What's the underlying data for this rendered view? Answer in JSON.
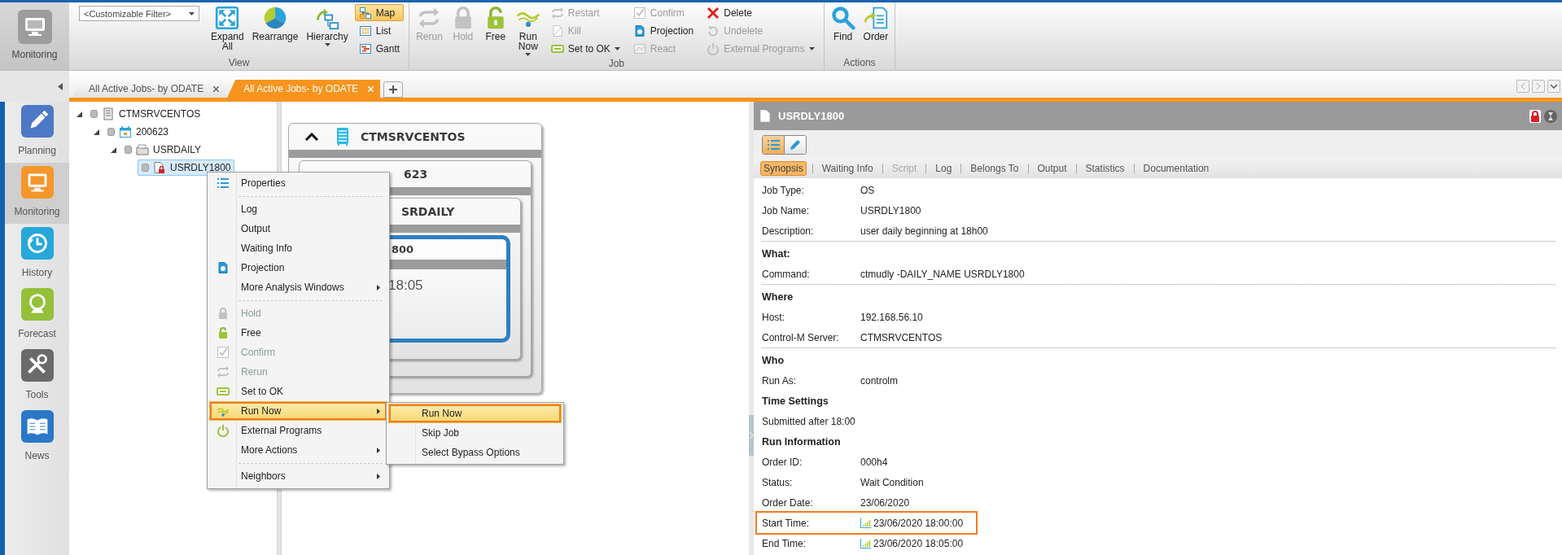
{
  "app_button": {
    "label": "Monitoring"
  },
  "filter": {
    "value": "<Customizable Filter>"
  },
  "ribbon_groups": [
    {
      "label": "View",
      "items": [
        {
          "kind": "large",
          "label": "Expand All",
          "disabled": false,
          "dropdown": false
        },
        {
          "kind": "large",
          "label": "Rearrange",
          "disabled": false,
          "dropdown": false
        },
        {
          "kind": "large",
          "label": "Hierarchy",
          "disabled": false,
          "dropdown": true
        },
        {
          "kind": "stack",
          "items": [
            {
              "label": "Map",
              "selected": true,
              "disabled": false,
              "dropdown": false
            },
            {
              "label": "List",
              "selected": false,
              "disabled": false,
              "dropdown": false
            },
            {
              "label": "Gantt",
              "selected": false,
              "disabled": false,
              "dropdown": false
            }
          ]
        }
      ]
    },
    {
      "label": "Job",
      "items": [
        {
          "kind": "large",
          "label": "Rerun",
          "disabled": true,
          "dropdown": false
        },
        {
          "kind": "large",
          "label": "Hold",
          "disabled": true,
          "dropdown": false
        },
        {
          "kind": "large",
          "label": "Free",
          "disabled": false,
          "dropdown": false
        },
        {
          "kind": "large",
          "label": "Run Now",
          "disabled": false,
          "dropdown": true
        },
        {
          "kind": "stack",
          "items": [
            {
              "label": "Restart",
              "disabled": true,
              "dropdown": false
            },
            {
              "label": "Kill",
              "disabled": true,
              "dropdown": false
            },
            {
              "label": "Set to OK",
              "disabled": false,
              "dropdown": true
            }
          ]
        },
        {
          "kind": "stack",
          "items": [
            {
              "label": "Confirm",
              "disabled": true,
              "dropdown": false
            },
            {
              "label": "Projection",
              "disabled": false,
              "dropdown": false
            },
            {
              "label": "React",
              "disabled": true,
              "dropdown": false
            }
          ]
        },
        {
          "kind": "stack",
          "items": [
            {
              "label": "Delete",
              "disabled": false,
              "dropdown": false
            },
            {
              "label": "Undelete",
              "disabled": true,
              "dropdown": false
            },
            {
              "label": "External Programs",
              "disabled": true,
              "dropdown": true
            }
          ]
        }
      ]
    },
    {
      "label": "Actions",
      "items": [
        {
          "kind": "large",
          "label": "Find",
          "disabled": false,
          "dropdown": false
        },
        {
          "kind": "large",
          "label": "Order",
          "disabled": false,
          "dropdown": false
        }
      ]
    }
  ],
  "tabs": [
    {
      "label": "All Active Jobs- by ODATE",
      "selected": false
    },
    {
      "label": "All Active Jobs- by ODATE",
      "selected": true
    }
  ],
  "nav": {
    "items": [
      {
        "label": "Planning",
        "selected": false
      },
      {
        "label": "Monitoring",
        "selected": true
      },
      {
        "label": "History",
        "selected": false
      },
      {
        "label": "Forecast",
        "selected": false
      },
      {
        "label": "Tools",
        "selected": false
      },
      {
        "label": "News",
        "selected": false
      }
    ]
  },
  "tree": [
    {
      "label": "CTMSRVCENTOS",
      "expanded": true,
      "selected": false,
      "children": [
        {
          "label": "200623",
          "expanded": true,
          "selected": false,
          "children": [
            {
              "label": "USRDAILY",
              "expanded": true,
              "selected": false,
              "children": [
                {
                  "label": "USRDLY1800",
                  "selected": true
                }
              ]
            }
          ]
        }
      ]
    }
  ],
  "map": {
    "cards": [
      {
        "title": "CTMSRVCENTOS",
        "kind": "group",
        "expanded": true,
        "children": [
          {
            "title": "623",
            "kind": "group",
            "children": [
              {
                "title": "SRDAILY",
                "kind": "group",
                "children": [
                  {
                    "title": "800",
                    "kind": "job",
                    "time": "18:05"
                  }
                ]
              }
            ]
          }
        ]
      }
    ]
  },
  "context_menu": {
    "sections": [
      [
        {
          "label": "Properties",
          "disabled": false,
          "submenu": false,
          "selected": false,
          "annotated": false
        }
      ],
      [
        {
          "label": "Log",
          "disabled": false,
          "submenu": false,
          "selected": false,
          "annotated": false
        },
        {
          "label": "Output",
          "disabled": false,
          "submenu": false,
          "selected": false,
          "annotated": false
        },
        {
          "label": "Waiting Info",
          "disabled": false,
          "submenu": false,
          "selected": false,
          "annotated": false
        },
        {
          "label": "Projection",
          "disabled": false,
          "submenu": false,
          "selected": false,
          "annotated": false
        },
        {
          "label": "More Analysis Windows",
          "disabled": false,
          "submenu": true,
          "selected": false,
          "annotated": false
        }
      ],
      [
        {
          "label": "Hold",
          "disabled": true,
          "submenu": false,
          "selected": false,
          "annotated": false
        },
        {
          "label": "Free",
          "disabled": false,
          "submenu": false,
          "selected": false,
          "annotated": false
        },
        {
          "label": "Confirm",
          "disabled": true,
          "submenu": false,
          "selected": false,
          "annotated": false
        },
        {
          "label": "Rerun",
          "disabled": true,
          "submenu": false,
          "selected": false,
          "annotated": false
        },
        {
          "label": "Set to OK",
          "disabled": false,
          "submenu": false,
          "selected": false,
          "annotated": false
        },
        {
          "label": "Run Now",
          "disabled": false,
          "submenu": true,
          "selected": true,
          "annotated": true
        },
        {
          "label": "External Programs",
          "disabled": false,
          "submenu": false,
          "selected": false,
          "annotated": false
        },
        {
          "label": "More Actions",
          "disabled": false,
          "submenu": true,
          "selected": false,
          "annotated": false
        }
      ],
      [
        {
          "label": "Neighbors",
          "disabled": false,
          "submenu": true,
          "selected": false,
          "annotated": false
        }
      ]
    ],
    "submenu": {
      "items": [
        {
          "label": "Run Now",
          "selected": true,
          "annotated": true
        },
        {
          "label": "Skip Job",
          "selected": false,
          "annotated": false
        },
        {
          "label": "Select Bypass Options",
          "selected": false,
          "annotated": false
        }
      ]
    }
  },
  "detail": {
    "title": "USRDLY1800",
    "view_toggle": [
      {
        "selected": true
      },
      {
        "selected": false
      }
    ],
    "tabs": [
      {
        "label": "Synopsis",
        "selected": true,
        "disabled": false
      },
      {
        "label": "Waiting Info",
        "selected": false,
        "disabled": false
      },
      {
        "label": "Script",
        "selected": false,
        "disabled": true
      },
      {
        "label": "Log",
        "selected": false,
        "disabled": false
      },
      {
        "label": "Belongs To",
        "selected": false,
        "disabled": false
      },
      {
        "label": "Output",
        "selected": false,
        "disabled": false
      },
      {
        "label": "Statistics",
        "selected": false,
        "disabled": false
      },
      {
        "label": "Documentation",
        "selected": false,
        "disabled": false
      }
    ],
    "sections": [
      {
        "divider": true,
        "rows": [
          {
            "kind": "field",
            "label": "Job Type:",
            "value": "OS",
            "annotated": false
          },
          {
            "kind": "field",
            "label": "Job Name:",
            "value": "USRDLY1800",
            "annotated": false
          },
          {
            "kind": "field",
            "label": "Description:",
            "value": "user daily beginning at 18h00",
            "annotated": false
          }
        ]
      },
      {
        "heading": "What:",
        "divider": true,
        "rows": [
          {
            "kind": "field",
            "label": "Command:",
            "value": "ctmudly -DAILY_NAME USRDLY1800",
            "annotated": false
          }
        ]
      },
      {
        "heading": "Where",
        "divider": true,
        "rows": [
          {
            "kind": "field",
            "label": "Host:",
            "value": "192.168.56.10",
            "annotated": false
          },
          {
            "kind": "field",
            "label": "Control-M Server:",
            "value": "CTMSRVCENTOS",
            "annotated": false
          }
        ]
      },
      {
        "heading": "Who",
        "divider": false,
        "rows": [
          {
            "kind": "field",
            "label": "Run As:",
            "value": "controlm",
            "annotated": false
          }
        ]
      },
      {
        "heading": "Time Settings",
        "divider": false,
        "rows": [
          {
            "kind": "note",
            "text": "Submitted after 18:00",
            "annotated": false
          }
        ]
      },
      {
        "heading": "Run Information",
        "divider": false,
        "rows": [
          {
            "kind": "field",
            "label": "Order ID:",
            "value": "000h4",
            "annotated": false
          },
          {
            "kind": "field",
            "label": "Status:",
            "value": "Wait Condition",
            "annotated": false
          },
          {
            "kind": "field",
            "label": "Order Date:",
            "value": "23/06/2020",
            "annotated": false
          },
          {
            "kind": "timestamp",
            "label": "Start Time:",
            "value": "23/06/2020 18:00:00",
            "annotated": true
          },
          {
            "kind": "timestamp",
            "label": "End Time:",
            "value": "23/06/2020 18:05:00",
            "annotated": false
          }
        ]
      }
    ]
  }
}
